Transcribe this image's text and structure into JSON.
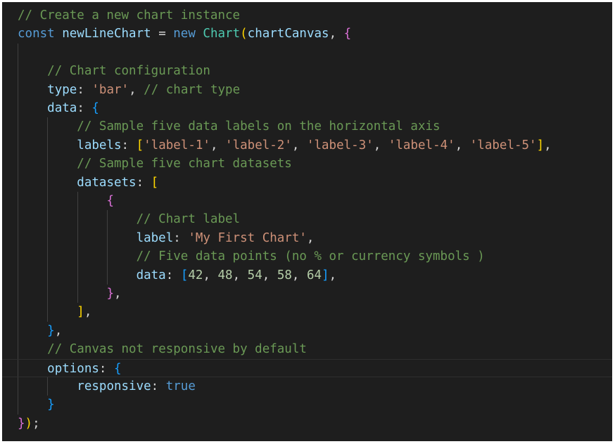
{
  "editor": {
    "theme_background": "#1e1e1e",
    "lines": [
      [
        {
          "t": "// Create a new chart instance",
          "c": "comment"
        }
      ],
      [
        {
          "t": "const ",
          "c": "keyword"
        },
        {
          "t": "newLineChart",
          "c": "variable"
        },
        {
          "t": " = ",
          "c": "punct"
        },
        {
          "t": "new ",
          "c": "keyword"
        },
        {
          "t": "Chart",
          "c": "class"
        },
        {
          "t": "(",
          "c": "bracket-1"
        },
        {
          "t": "chartCanvas",
          "c": "variable"
        },
        {
          "t": ", ",
          "c": "punct"
        },
        {
          "t": "{",
          "c": "bracket-2"
        }
      ],
      [],
      [
        {
          "t": "    "
        },
        {
          "t": "// Chart configuration",
          "c": "comment"
        }
      ],
      [
        {
          "t": "    "
        },
        {
          "t": "type",
          "c": "variable"
        },
        {
          "t": ": ",
          "c": "punct"
        },
        {
          "t": "'bar'",
          "c": "string"
        },
        {
          "t": ", ",
          "c": "punct"
        },
        {
          "t": "// chart type",
          "c": "comment"
        }
      ],
      [
        {
          "t": "    "
        },
        {
          "t": "data",
          "c": "variable"
        },
        {
          "t": ": ",
          "c": "punct"
        },
        {
          "t": "{",
          "c": "bracket-3"
        }
      ],
      [
        {
          "t": "        "
        },
        {
          "t": "// Sample five data labels on the horizontal axis",
          "c": "comment"
        }
      ],
      [
        {
          "t": "        "
        },
        {
          "t": "labels",
          "c": "variable"
        },
        {
          "t": ": ",
          "c": "punct"
        },
        {
          "t": "[",
          "c": "bracket-1"
        },
        {
          "t": "'label-1'",
          "c": "string"
        },
        {
          "t": ", ",
          "c": "punct"
        },
        {
          "t": "'label-2'",
          "c": "string"
        },
        {
          "t": ", ",
          "c": "punct"
        },
        {
          "t": "'label-3'",
          "c": "string"
        },
        {
          "t": ", ",
          "c": "punct"
        },
        {
          "t": "'label-4'",
          "c": "string"
        },
        {
          "t": ", ",
          "c": "punct"
        },
        {
          "t": "'label-5'",
          "c": "string"
        },
        {
          "t": "]",
          "c": "bracket-1"
        },
        {
          "t": ",",
          "c": "punct"
        }
      ],
      [
        {
          "t": "        "
        },
        {
          "t": "// Sample five chart datasets",
          "c": "comment"
        }
      ],
      [
        {
          "t": "        "
        },
        {
          "t": "datasets",
          "c": "variable"
        },
        {
          "t": ": ",
          "c": "punct"
        },
        {
          "t": "[",
          "c": "bracket-1"
        }
      ],
      [
        {
          "t": "            "
        },
        {
          "t": "{",
          "c": "bracket-2"
        }
      ],
      [
        {
          "t": "                "
        },
        {
          "t": "// Chart label",
          "c": "comment"
        }
      ],
      [
        {
          "t": "                "
        },
        {
          "t": "label",
          "c": "variable"
        },
        {
          "t": ": ",
          "c": "punct"
        },
        {
          "t": "'My First Chart'",
          "c": "string"
        },
        {
          "t": ",",
          "c": "punct"
        }
      ],
      [
        {
          "t": "                "
        },
        {
          "t": "// Five data points (no % or currency symbols )",
          "c": "comment"
        }
      ],
      [
        {
          "t": "                "
        },
        {
          "t": "data",
          "c": "variable"
        },
        {
          "t": ": ",
          "c": "punct"
        },
        {
          "t": "[",
          "c": "bracket-3"
        },
        {
          "t": "42",
          "c": "number"
        },
        {
          "t": ", ",
          "c": "punct"
        },
        {
          "t": "48",
          "c": "number"
        },
        {
          "t": ", ",
          "c": "punct"
        },
        {
          "t": "54",
          "c": "number"
        },
        {
          "t": ", ",
          "c": "punct"
        },
        {
          "t": "58",
          "c": "number"
        },
        {
          "t": ", ",
          "c": "punct"
        },
        {
          "t": "64",
          "c": "number"
        },
        {
          "t": "]",
          "c": "bracket-3"
        },
        {
          "t": ",",
          "c": "punct"
        }
      ],
      [
        {
          "t": "            "
        },
        {
          "t": "}",
          "c": "bracket-2"
        },
        {
          "t": ",",
          "c": "punct"
        }
      ],
      [
        {
          "t": "        "
        },
        {
          "t": "]",
          "c": "bracket-1"
        },
        {
          "t": ",",
          "c": "punct"
        }
      ],
      [
        {
          "t": "    "
        },
        {
          "t": "}",
          "c": "bracket-3"
        },
        {
          "t": ",",
          "c": "punct"
        }
      ],
      [
        {
          "t": "    "
        },
        {
          "t": "// Canvas not responsive by default",
          "c": "comment"
        }
      ],
      [
        {
          "t": "    "
        },
        {
          "t": "options",
          "c": "variable"
        },
        {
          "t": ": ",
          "c": "punct"
        },
        {
          "t": "{",
          "c": "bracket-3"
        }
      ],
      [
        {
          "t": "        "
        },
        {
          "t": "responsive",
          "c": "variable"
        },
        {
          "t": ": ",
          "c": "punct"
        },
        {
          "t": "true",
          "c": "keyword"
        }
      ],
      [
        {
          "t": "    "
        },
        {
          "t": "}",
          "c": "bracket-3"
        }
      ],
      [
        {
          "t": "}",
          "c": "bracket-2"
        },
        {
          "t": ")",
          "c": "bracket-1"
        },
        {
          "t": ";",
          "c": "punct"
        }
      ]
    ]
  }
}
